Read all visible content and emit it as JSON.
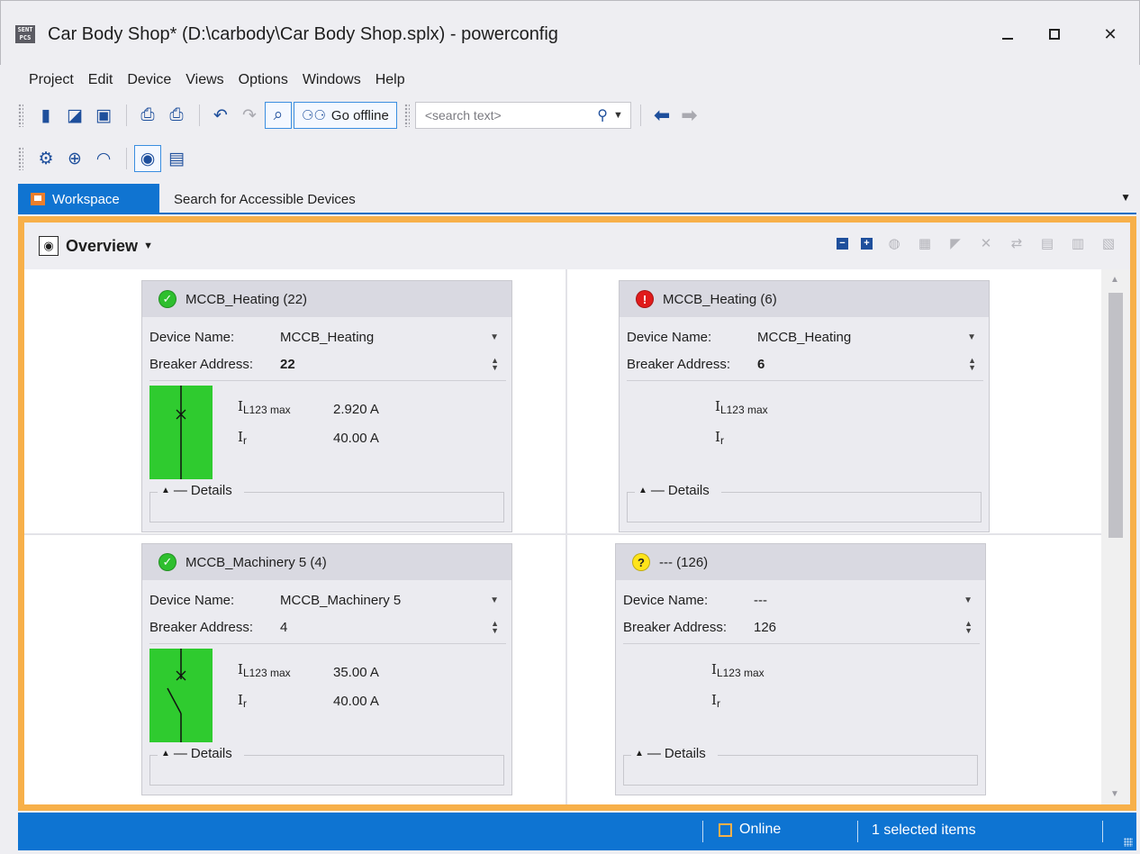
{
  "window": {
    "title": "Car Body Shop* (D:\\carbody\\Car Body Shop.splx) - powerconfig",
    "logo_text": "SENT PCS"
  },
  "menu": [
    "Project",
    "Edit",
    "Device",
    "Views",
    "Options",
    "Windows",
    "Help"
  ],
  "toolbar": {
    "go_offline_label": "Go offline",
    "search_placeholder": "<search text>"
  },
  "tabs": {
    "workspace": "Workspace",
    "search_devices": "Search for Accessible Devices"
  },
  "overview": {
    "title": "Overview"
  },
  "cards": [
    {
      "title": "MCCB_Heating (22)",
      "status": "ok",
      "device_name_label": "Device Name:",
      "device_name": "MCCB_Heating",
      "breaker_address_label": "Breaker Address:",
      "breaker_address": "22",
      "ilmax_value": "2.920 A",
      "ir_value": "40.00 A",
      "breaker_state": "closed",
      "details_label": "Details"
    },
    {
      "title": "MCCB_Heating (6)",
      "status": "error",
      "device_name_label": "Device Name:",
      "device_name": "MCCB_Heating",
      "breaker_address_label": "Breaker Address:",
      "breaker_address": "6",
      "ilmax_value": "",
      "ir_value": "",
      "details_label": "Details"
    },
    {
      "title": "MCCB_Machinery 5 (4)",
      "status": "ok",
      "device_name_label": "Device Name:",
      "device_name": "MCCB_Machinery 5",
      "breaker_address_label": "Breaker Address:",
      "breaker_address": "4",
      "ilmax_value": "35.00 A",
      "ir_value": "40.00 A",
      "breaker_state": "open",
      "details_label": "Details"
    },
    {
      "title": "--- (126)",
      "status": "unknown",
      "device_name_label": "Device Name:",
      "device_name": "---",
      "breaker_address_label": "Breaker Address:",
      "breaker_address": "126",
      "ilmax_value": "",
      "ir_value": "",
      "details_label": "Details"
    }
  ],
  "measure_labels": {
    "i_main": "I",
    "ilmax_sub": "L123 max",
    "ir_sub": "r"
  },
  "statusbar": {
    "online_label": "Online",
    "selected_label": "1 selected items"
  },
  "colors": {
    "accent_blue": "#0e74d2",
    "frame_orange": "#f7b04a",
    "breaker_green": "#2fcb2f",
    "status_ok": "#2ebf2e",
    "status_error": "#e01b1b",
    "status_unknown": "#ffe41a"
  }
}
